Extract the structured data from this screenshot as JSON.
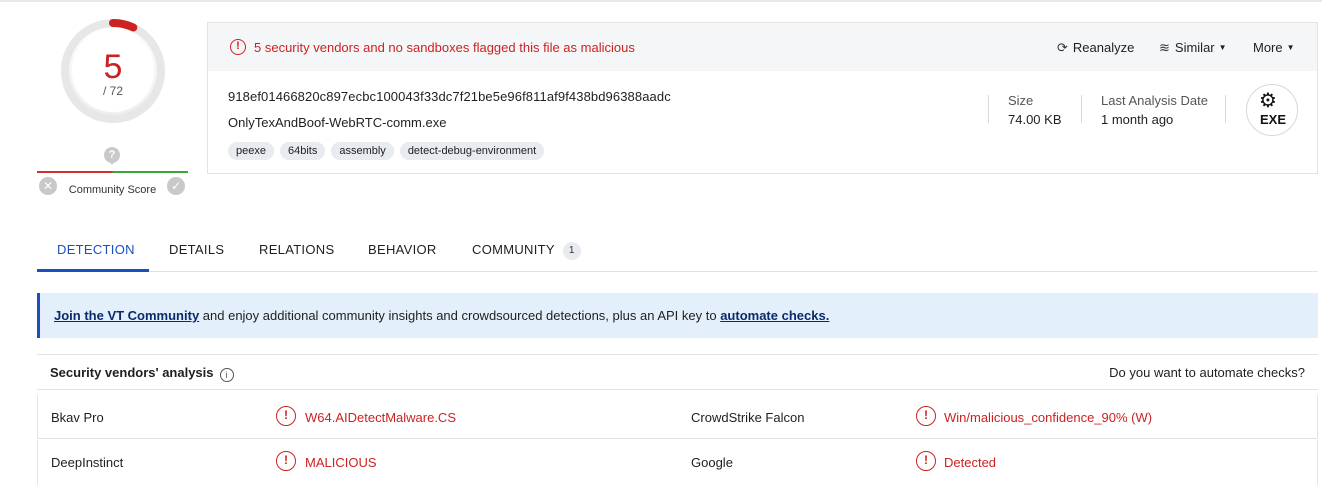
{
  "score": {
    "detections": "5",
    "total": "/ 72",
    "detections_value": 5,
    "total_value": 72,
    "accent_color": "#cc2222"
  },
  "community": {
    "label": "Community Score",
    "question_icon": "question-icon",
    "down_icon": "close-icon",
    "up_icon": "check-icon"
  },
  "alert": {
    "icon": "alert-circle-icon",
    "text": "5 security vendors and no sandboxes flagged this file as malicious"
  },
  "actions": {
    "reanalyze": "Reanalyze",
    "similar": "Similar",
    "more": "More"
  },
  "file": {
    "hash": "918ef01466820c897ecbc100043f33dc7f21be5e96f811af9f438bd96388aadc",
    "name": "OnlyTexAndBoof-WebRTC-comm.exe",
    "tags": [
      "peexe",
      "64bits",
      "assembly",
      "detect-debug-environment"
    ],
    "size_label": "Size",
    "size_value": "74.00 KB",
    "date_label": "Last Analysis Date",
    "date_value": "1 month ago",
    "type_badge": "EXE"
  },
  "tabs": [
    {
      "label": "DETECTION",
      "active": true
    },
    {
      "label": "DETAILS"
    },
    {
      "label": "RELATIONS"
    },
    {
      "label": "BEHAVIOR"
    },
    {
      "label": "COMMUNITY",
      "count": "1"
    }
  ],
  "banner": {
    "link1": "Join the VT Community",
    "middle": " and enjoy additional community insights and crowdsourced detections, plus an API key to ",
    "link2": "automate checks."
  },
  "vendors": {
    "title": "Security vendors' analysis",
    "automate": "Do you want to automate checks?",
    "rows": [
      {
        "left_vendor": "Bkav Pro",
        "left_result": "W64.AIDetectMalware.CS",
        "right_vendor": "CrowdStrike Falcon",
        "right_result": "Win/malicious_confidence_90% (W)"
      },
      {
        "left_vendor": "DeepInstinct",
        "left_result": "MALICIOUS",
        "right_vendor": "Google",
        "right_result": "Detected"
      }
    ]
  },
  "colors": {
    "malicious": "#cc2222",
    "active_tab": "#1a4fbf",
    "banner_bg": "#e3f0fb"
  }
}
